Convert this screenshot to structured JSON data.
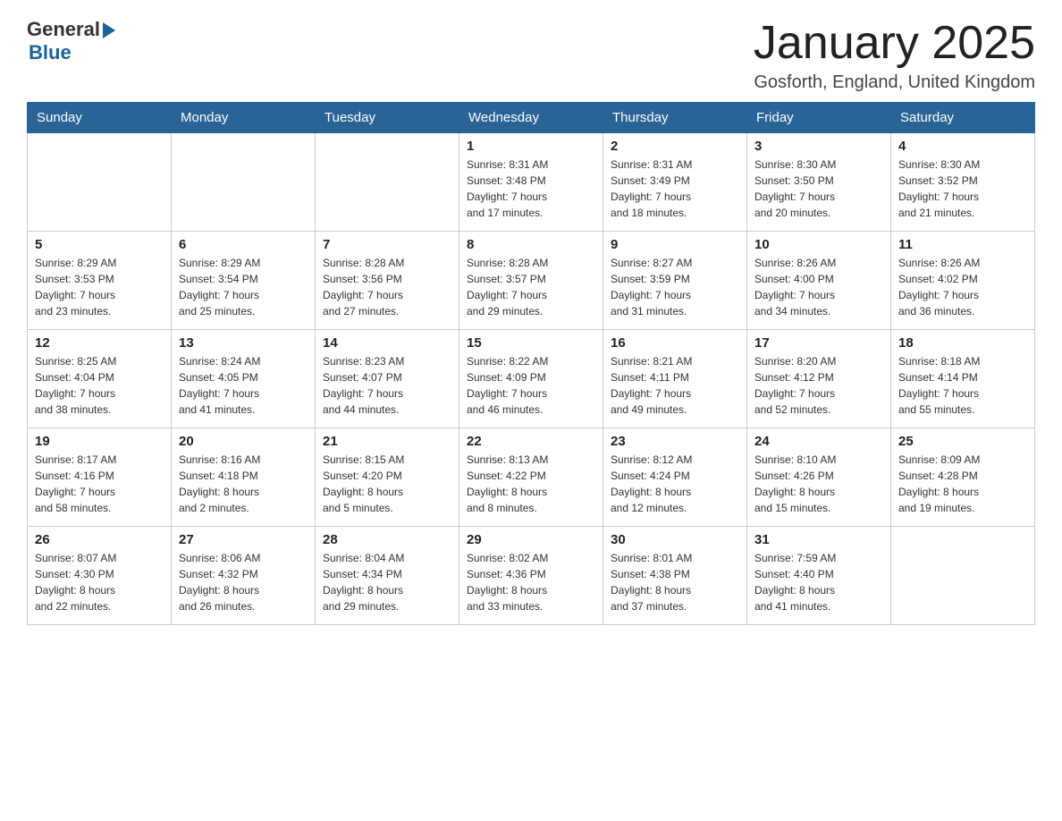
{
  "header": {
    "logo_general": "General",
    "logo_blue": "Blue",
    "month_title": "January 2025",
    "location": "Gosforth, England, United Kingdom"
  },
  "calendar": {
    "days_of_week": [
      "Sunday",
      "Monday",
      "Tuesday",
      "Wednesday",
      "Thursday",
      "Friday",
      "Saturday"
    ],
    "weeks": [
      {
        "days": [
          {
            "number": "",
            "info": ""
          },
          {
            "number": "",
            "info": ""
          },
          {
            "number": "",
            "info": ""
          },
          {
            "number": "1",
            "info": "Sunrise: 8:31 AM\nSunset: 3:48 PM\nDaylight: 7 hours\nand 17 minutes."
          },
          {
            "number": "2",
            "info": "Sunrise: 8:31 AM\nSunset: 3:49 PM\nDaylight: 7 hours\nand 18 minutes."
          },
          {
            "number": "3",
            "info": "Sunrise: 8:30 AM\nSunset: 3:50 PM\nDaylight: 7 hours\nand 20 minutes."
          },
          {
            "number": "4",
            "info": "Sunrise: 8:30 AM\nSunset: 3:52 PM\nDaylight: 7 hours\nand 21 minutes."
          }
        ]
      },
      {
        "days": [
          {
            "number": "5",
            "info": "Sunrise: 8:29 AM\nSunset: 3:53 PM\nDaylight: 7 hours\nand 23 minutes."
          },
          {
            "number": "6",
            "info": "Sunrise: 8:29 AM\nSunset: 3:54 PM\nDaylight: 7 hours\nand 25 minutes."
          },
          {
            "number": "7",
            "info": "Sunrise: 8:28 AM\nSunset: 3:56 PM\nDaylight: 7 hours\nand 27 minutes."
          },
          {
            "number": "8",
            "info": "Sunrise: 8:28 AM\nSunset: 3:57 PM\nDaylight: 7 hours\nand 29 minutes."
          },
          {
            "number": "9",
            "info": "Sunrise: 8:27 AM\nSunset: 3:59 PM\nDaylight: 7 hours\nand 31 minutes."
          },
          {
            "number": "10",
            "info": "Sunrise: 8:26 AM\nSunset: 4:00 PM\nDaylight: 7 hours\nand 34 minutes."
          },
          {
            "number": "11",
            "info": "Sunrise: 8:26 AM\nSunset: 4:02 PM\nDaylight: 7 hours\nand 36 minutes."
          }
        ]
      },
      {
        "days": [
          {
            "number": "12",
            "info": "Sunrise: 8:25 AM\nSunset: 4:04 PM\nDaylight: 7 hours\nand 38 minutes."
          },
          {
            "number": "13",
            "info": "Sunrise: 8:24 AM\nSunset: 4:05 PM\nDaylight: 7 hours\nand 41 minutes."
          },
          {
            "number": "14",
            "info": "Sunrise: 8:23 AM\nSunset: 4:07 PM\nDaylight: 7 hours\nand 44 minutes."
          },
          {
            "number": "15",
            "info": "Sunrise: 8:22 AM\nSunset: 4:09 PM\nDaylight: 7 hours\nand 46 minutes."
          },
          {
            "number": "16",
            "info": "Sunrise: 8:21 AM\nSunset: 4:11 PM\nDaylight: 7 hours\nand 49 minutes."
          },
          {
            "number": "17",
            "info": "Sunrise: 8:20 AM\nSunset: 4:12 PM\nDaylight: 7 hours\nand 52 minutes."
          },
          {
            "number": "18",
            "info": "Sunrise: 8:18 AM\nSunset: 4:14 PM\nDaylight: 7 hours\nand 55 minutes."
          }
        ]
      },
      {
        "days": [
          {
            "number": "19",
            "info": "Sunrise: 8:17 AM\nSunset: 4:16 PM\nDaylight: 7 hours\nand 58 minutes."
          },
          {
            "number": "20",
            "info": "Sunrise: 8:16 AM\nSunset: 4:18 PM\nDaylight: 8 hours\nand 2 minutes."
          },
          {
            "number": "21",
            "info": "Sunrise: 8:15 AM\nSunset: 4:20 PM\nDaylight: 8 hours\nand 5 minutes."
          },
          {
            "number": "22",
            "info": "Sunrise: 8:13 AM\nSunset: 4:22 PM\nDaylight: 8 hours\nand 8 minutes."
          },
          {
            "number": "23",
            "info": "Sunrise: 8:12 AM\nSunset: 4:24 PM\nDaylight: 8 hours\nand 12 minutes."
          },
          {
            "number": "24",
            "info": "Sunrise: 8:10 AM\nSunset: 4:26 PM\nDaylight: 8 hours\nand 15 minutes."
          },
          {
            "number": "25",
            "info": "Sunrise: 8:09 AM\nSunset: 4:28 PM\nDaylight: 8 hours\nand 19 minutes."
          }
        ]
      },
      {
        "days": [
          {
            "number": "26",
            "info": "Sunrise: 8:07 AM\nSunset: 4:30 PM\nDaylight: 8 hours\nand 22 minutes."
          },
          {
            "number": "27",
            "info": "Sunrise: 8:06 AM\nSunset: 4:32 PM\nDaylight: 8 hours\nand 26 minutes."
          },
          {
            "number": "28",
            "info": "Sunrise: 8:04 AM\nSunset: 4:34 PM\nDaylight: 8 hours\nand 29 minutes."
          },
          {
            "number": "29",
            "info": "Sunrise: 8:02 AM\nSunset: 4:36 PM\nDaylight: 8 hours\nand 33 minutes."
          },
          {
            "number": "30",
            "info": "Sunrise: 8:01 AM\nSunset: 4:38 PM\nDaylight: 8 hours\nand 37 minutes."
          },
          {
            "number": "31",
            "info": "Sunrise: 7:59 AM\nSunset: 4:40 PM\nDaylight: 8 hours\nand 41 minutes."
          },
          {
            "number": "",
            "info": ""
          }
        ]
      }
    ]
  }
}
